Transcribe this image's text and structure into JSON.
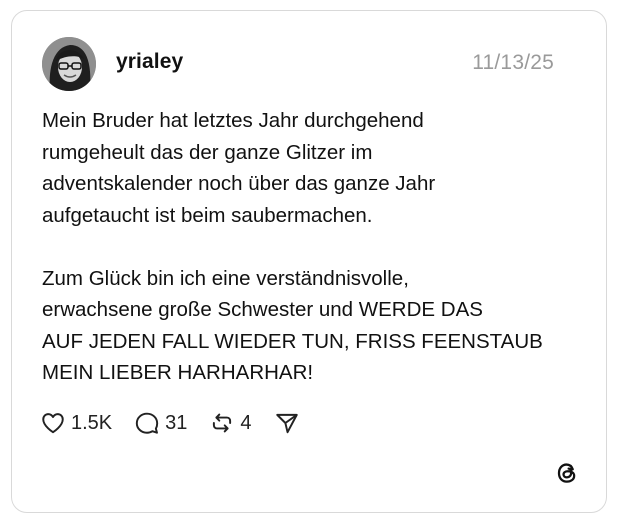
{
  "post": {
    "username": "yrialey",
    "date": "11/13/25",
    "paragraphs": [
      "Mein Bruder hat letztes Jahr durchgehend\nrumgeheult das der ganze Glitzer im\nadventskalender noch über das ganze Jahr\naufgetaucht ist beim saubermachen.",
      "Zum Glück bin ich eine verständnisvolle,\nerwachsene große Schwester und WERDE DAS\nAUF JEDEN FALL WIEDER TUN, FRISS FEENSTAUB\nMEIN LIEBER HARHARHAR!"
    ]
  },
  "actions": {
    "likes": "1.5K",
    "comments": "31",
    "reposts": "4"
  },
  "icons": {
    "like": "heart-icon",
    "comment": "comment-bubble-icon",
    "repost": "repost-icon",
    "share": "send-icon",
    "brand": "threads-logo-icon"
  }
}
